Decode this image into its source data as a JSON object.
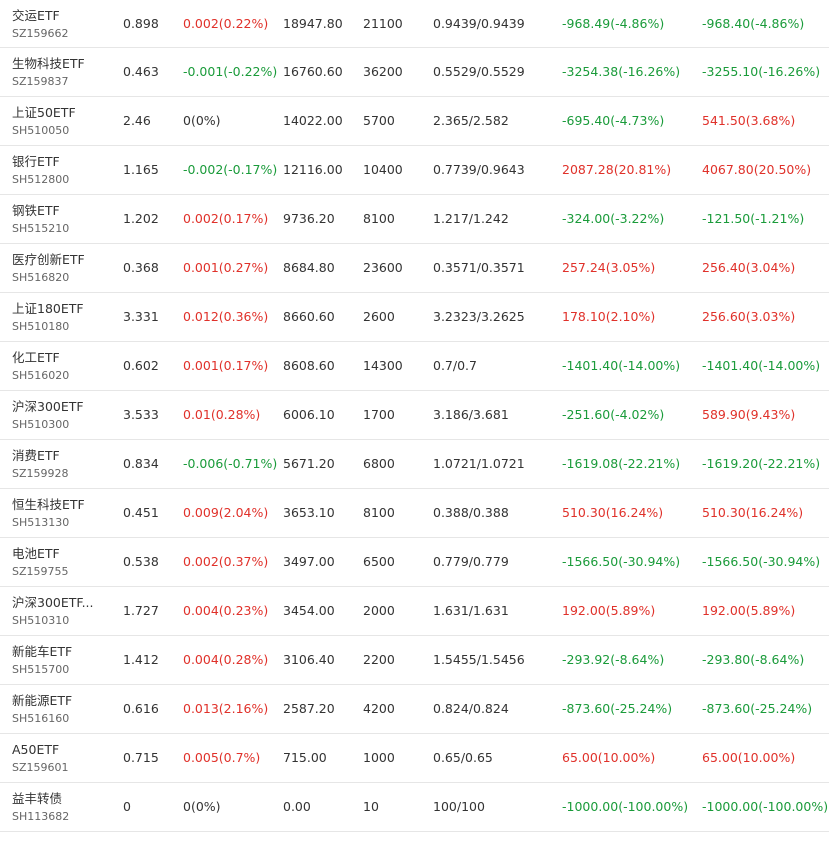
{
  "colors": {
    "up": "#e0312a",
    "down": "#1a9b3a",
    "flat": "#333333"
  },
  "rows": [
    {
      "name": "交运ETF",
      "code": "SZ159662",
      "price": "0.898",
      "change": "0.002(0.22%)",
      "change_dir": "up",
      "value": "18947.80",
      "qty": "21100",
      "cost": "0.9439/0.9439",
      "pnl1": "-968.49(-4.86%)",
      "pnl1_dir": "down",
      "pnl2": "-968.40(-4.86%)",
      "pnl2_dir": "down"
    },
    {
      "name": "生物科技ETF",
      "code": "SZ159837",
      "price": "0.463",
      "change": "-0.001(-0.22%)",
      "change_dir": "down",
      "value": "16760.60",
      "qty": "36200",
      "cost": "0.5529/0.5529",
      "pnl1": "-3254.38(-16.26%)",
      "pnl1_dir": "down",
      "pnl2": "-3255.10(-16.26%)",
      "pnl2_dir": "down"
    },
    {
      "name": "上证50ETF",
      "code": "SH510050",
      "price": "2.46",
      "change": "0(0%)",
      "change_dir": "flat",
      "value": "14022.00",
      "qty": "5700",
      "cost": "2.365/2.582",
      "pnl1": "-695.40(-4.73%)",
      "pnl1_dir": "down",
      "pnl2": "541.50(3.68%)",
      "pnl2_dir": "up"
    },
    {
      "name": "银行ETF",
      "code": "SH512800",
      "price": "1.165",
      "change": "-0.002(-0.17%)",
      "change_dir": "down",
      "value": "12116.00",
      "qty": "10400",
      "cost": "0.7739/0.9643",
      "pnl1": "2087.28(20.81%)",
      "pnl1_dir": "up",
      "pnl2": "4067.80(20.50%)",
      "pnl2_dir": "up"
    },
    {
      "name": "钢铁ETF",
      "code": "SH515210",
      "price": "1.202",
      "change": "0.002(0.17%)",
      "change_dir": "up",
      "value": "9736.20",
      "qty": "8100",
      "cost": "1.217/1.242",
      "pnl1": "-324.00(-3.22%)",
      "pnl1_dir": "down",
      "pnl2": "-121.50(-1.21%)",
      "pnl2_dir": "down"
    },
    {
      "name": "医疗创新ETF",
      "code": "SH516820",
      "price": "0.368",
      "change": "0.001(0.27%)",
      "change_dir": "up",
      "value": "8684.80",
      "qty": "23600",
      "cost": "0.3571/0.3571",
      "pnl1": "257.24(3.05%)",
      "pnl1_dir": "up",
      "pnl2": "256.40(3.04%)",
      "pnl2_dir": "up"
    },
    {
      "name": "上证180ETF",
      "code": "SH510180",
      "price": "3.331",
      "change": "0.012(0.36%)",
      "change_dir": "up",
      "value": "8660.60",
      "qty": "2600",
      "cost": "3.2323/3.2625",
      "pnl1": "178.10(2.10%)",
      "pnl1_dir": "up",
      "pnl2": "256.60(3.03%)",
      "pnl2_dir": "up"
    },
    {
      "name": "化工ETF",
      "code": "SH516020",
      "price": "0.602",
      "change": "0.001(0.17%)",
      "change_dir": "up",
      "value": "8608.60",
      "qty": "14300",
      "cost": "0.7/0.7",
      "pnl1": "-1401.40(-14.00%)",
      "pnl1_dir": "down",
      "pnl2": "-1401.40(-14.00%)",
      "pnl2_dir": "down"
    },
    {
      "name": "沪深300ETF",
      "code": "SH510300",
      "price": "3.533",
      "change": "0.01(0.28%)",
      "change_dir": "up",
      "value": "6006.10",
      "qty": "1700",
      "cost": "3.186/3.681",
      "pnl1": "-251.60(-4.02%)",
      "pnl1_dir": "down",
      "pnl2": "589.90(9.43%)",
      "pnl2_dir": "up"
    },
    {
      "name": "消费ETF",
      "code": "SZ159928",
      "price": "0.834",
      "change": "-0.006(-0.71%)",
      "change_dir": "down",
      "value": "5671.20",
      "qty": "6800",
      "cost": "1.0721/1.0721",
      "pnl1": "-1619.08(-22.21%)",
      "pnl1_dir": "down",
      "pnl2": "-1619.20(-22.21%)",
      "pnl2_dir": "down"
    },
    {
      "name": "恒生科技ETF",
      "code": "SH513130",
      "price": "0.451",
      "change": "0.009(2.04%)",
      "change_dir": "up",
      "value": "3653.10",
      "qty": "8100",
      "cost": "0.388/0.388",
      "pnl1": "510.30(16.24%)",
      "pnl1_dir": "up",
      "pnl2": "510.30(16.24%)",
      "pnl2_dir": "up"
    },
    {
      "name": "电池ETF",
      "code": "SZ159755",
      "price": "0.538",
      "change": "0.002(0.37%)",
      "change_dir": "up",
      "value": "3497.00",
      "qty": "6500",
      "cost": "0.779/0.779",
      "pnl1": "-1566.50(-30.94%)",
      "pnl1_dir": "down",
      "pnl2": "-1566.50(-30.94%)",
      "pnl2_dir": "down"
    },
    {
      "name": "沪深300ETF...",
      "code": "SH510310",
      "price": "1.727",
      "change": "0.004(0.23%)",
      "change_dir": "up",
      "value": "3454.00",
      "qty": "2000",
      "cost": "1.631/1.631",
      "pnl1": "192.00(5.89%)",
      "pnl1_dir": "up",
      "pnl2": "192.00(5.89%)",
      "pnl2_dir": "up"
    },
    {
      "name": "新能车ETF",
      "code": "SH515700",
      "price": "1.412",
      "change": "0.004(0.28%)",
      "change_dir": "up",
      "value": "3106.40",
      "qty": "2200",
      "cost": "1.5455/1.5456",
      "pnl1": "-293.92(-8.64%)",
      "pnl1_dir": "down",
      "pnl2": "-293.80(-8.64%)",
      "pnl2_dir": "down"
    },
    {
      "name": "新能源ETF",
      "code": "SH516160",
      "price": "0.616",
      "change": "0.013(2.16%)",
      "change_dir": "up",
      "value": "2587.20",
      "qty": "4200",
      "cost": "0.824/0.824",
      "pnl1": "-873.60(-25.24%)",
      "pnl1_dir": "down",
      "pnl2": "-873.60(-25.24%)",
      "pnl2_dir": "down"
    },
    {
      "name": "A50ETF",
      "code": "SZ159601",
      "price": "0.715",
      "change": "0.005(0.7%)",
      "change_dir": "up",
      "value": "715.00",
      "qty": "1000",
      "cost": "0.65/0.65",
      "pnl1": "65.00(10.00%)",
      "pnl1_dir": "up",
      "pnl2": "65.00(10.00%)",
      "pnl2_dir": "up"
    },
    {
      "name": "益丰转债",
      "code": "SH113682",
      "price": "0",
      "change": "0(0%)",
      "change_dir": "flat",
      "value": "0.00",
      "qty": "10",
      "cost": "100/100",
      "pnl1": "-1000.00(-100.00%)",
      "pnl1_dir": "down",
      "pnl2": "-1000.00(-100.00%)",
      "pnl2_dir": "down"
    }
  ]
}
